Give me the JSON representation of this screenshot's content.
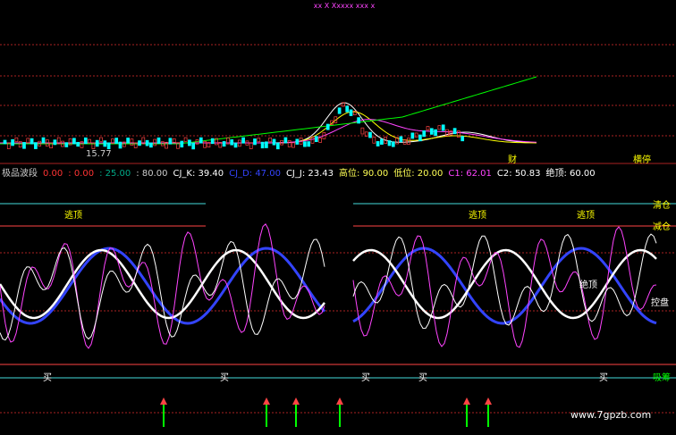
{
  "header_text": "xx  X  Xxxxx  xxx  x",
  "upper_panel": {
    "low_price_label": "15.77",
    "arrow_label": "←",
    "cai_label": "财",
    "top_right_label": "横停"
  },
  "indicator_header": [
    {
      "text": "极品波段",
      "color": "#cccccc"
    },
    {
      "text": "0.00",
      "color": "#ff3333"
    },
    {
      "text": ": 0.00",
      "color": "#ff3333"
    },
    {
      "text": ": 25.00",
      "color": "#00aa88"
    },
    {
      "text": ": 80.00",
      "color": "#cccccc"
    },
    {
      "text": "CJ_K: 39.40",
      "color": "#ffffff"
    },
    {
      "text": "CJ_D: 47.00",
      "color": "#3344ff"
    },
    {
      "text": "CJ_J: 23.43",
      "color": "#ffffff"
    },
    {
      "text": "高位: 90.00",
      "color": "#ffff55"
    },
    {
      "text": "低位: 20.00",
      "color": "#ffff55"
    },
    {
      "text": "C1: 62.01",
      "color": "#ff44ff"
    },
    {
      "text": "C2: 50.83",
      "color": "#ffffff"
    },
    {
      "text": "绝顶: 60.00",
      "color": "#ffffff"
    }
  ],
  "lower_labels": {
    "escape_top_1": "逃顶",
    "escape_top_2": "逃顶",
    "escape_top_3": "逃顶",
    "clear_position": "清仓",
    "reduce_position": "减仓",
    "control_panel": "控盘",
    "absorb": "吸筹",
    "buy": "买",
    "absolute_top": "绝顶"
  },
  "watermark": "www.7gpzb.com",
  "colors": {
    "kline_up": "#ff4444",
    "kline_down": "#00ffff",
    "ma1": "#ffffff",
    "ma2": "#ffff00",
    "ma3": "#ff44ff",
    "ma4": "#00ff00",
    "cj_k": "#ffffff",
    "cj_d": "#3344ff",
    "cj_j": "#ffffff",
    "c1": "#ff44ff",
    "c2": "#ffffff",
    "line_cyan": "#44dddd",
    "line_red": "#ff4444",
    "buy_signal": "#00ff00"
  },
  "chart_data": {
    "type": "line",
    "title": "",
    "indicator": "极品波段",
    "reference_levels": {
      "清仓": 90,
      "减仓": 80,
      "吸筹": 20,
      "低位": 20,
      "高位": 90
    },
    "series": [
      {
        "name": "CJ_K",
        "last": 39.4
      },
      {
        "name": "CJ_D",
        "last": 47.0
      },
      {
        "name": "CJ_J",
        "last": 23.43
      },
      {
        "name": "C1",
        "last": 62.01
      },
      {
        "name": "C2",
        "last": 50.83
      }
    ],
    "price_low": 15.77
  }
}
